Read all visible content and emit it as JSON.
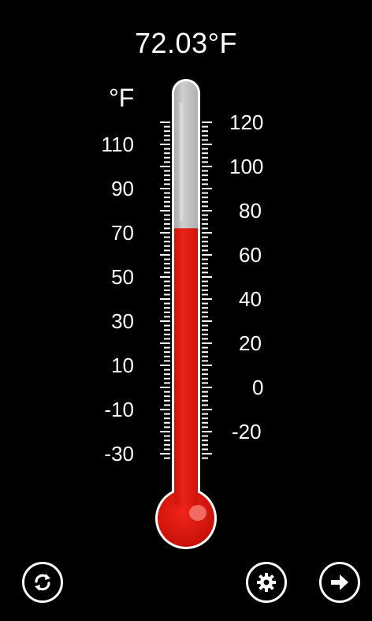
{
  "reading": {
    "value": 72.03,
    "text": "72.03°F"
  },
  "scale": {
    "unit": "°F",
    "left_labels": [
      "110",
      "90",
      "70",
      "50",
      "30",
      "10",
      "-10",
      "-30"
    ],
    "right_labels": [
      "120",
      "100",
      "80",
      "60",
      "40",
      "20",
      "0",
      "-20"
    ]
  },
  "colors": {
    "background": "#000000",
    "mercury": "#e0190f",
    "tube_empty": "#bdbdbd",
    "text": "#ffffff"
  },
  "toolbar": {
    "refresh_icon": "refresh-icon",
    "settings_icon": "gear-icon",
    "next_icon": "arrow-right-icon"
  }
}
